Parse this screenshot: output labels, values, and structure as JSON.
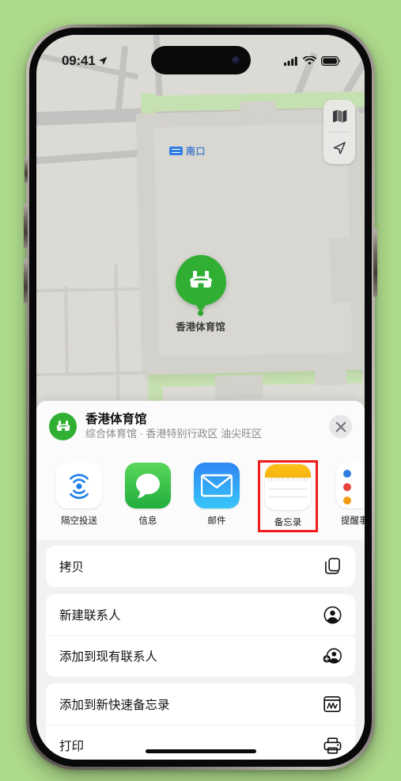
{
  "status_bar": {
    "time": "09:41",
    "location_arrow_icon": "location-arrow-icon",
    "cellular_icon": "cellular-signal-icon",
    "wifi_icon": "wifi-icon",
    "battery_icon": "battery-full-icon"
  },
  "map": {
    "transit_label": "南口",
    "transit_badge_icon": "transit-station-icon",
    "pin_label": "香港体育馆",
    "pin_icon": "stadium-icon",
    "controls": [
      {
        "name": "map-layers-button",
        "icon": "map-icon"
      },
      {
        "name": "locate-me-button",
        "icon": "navigation-arrow-icon"
      }
    ],
    "colors": {
      "base": "#dcdad4",
      "road": "#c3c2c0",
      "park": "#c6e1b1",
      "building": "#d3d1cc",
      "pin": "#30af32",
      "transit_text": "#4d82cd"
    }
  },
  "share_sheet": {
    "place_title": "香港体育馆",
    "place_subtitle": "综合体育馆 · 香港特别行政区 油尖旺区",
    "avatar_icon": "stadium-icon",
    "close_icon": "close-icon",
    "apps": [
      {
        "label": "隔空投送",
        "icon": "airdrop-icon",
        "highlighted": false
      },
      {
        "label": "信息",
        "icon": "messages-icon",
        "highlighted": false
      },
      {
        "label": "邮件",
        "icon": "mail-icon",
        "highlighted": false
      },
      {
        "label": "备忘录",
        "icon": "notes-icon",
        "highlighted": true
      },
      {
        "label": "提醒事项",
        "icon": "reminders-icon",
        "highlighted": false
      }
    ],
    "highlight_color": "#f01c1c",
    "action_groups": [
      {
        "rows": [
          {
            "label": "拷贝",
            "icon": "copy-icon"
          }
        ]
      },
      {
        "rows": [
          {
            "label": "新建联系人",
            "icon": "person-circle-icon"
          },
          {
            "label": "添加到现有联系人",
            "icon": "person-add-icon"
          }
        ]
      },
      {
        "rows": [
          {
            "label": "添加到新快速备忘录",
            "icon": "quick-note-icon"
          },
          {
            "label": "打印",
            "icon": "printer-icon"
          }
        ]
      }
    ]
  }
}
